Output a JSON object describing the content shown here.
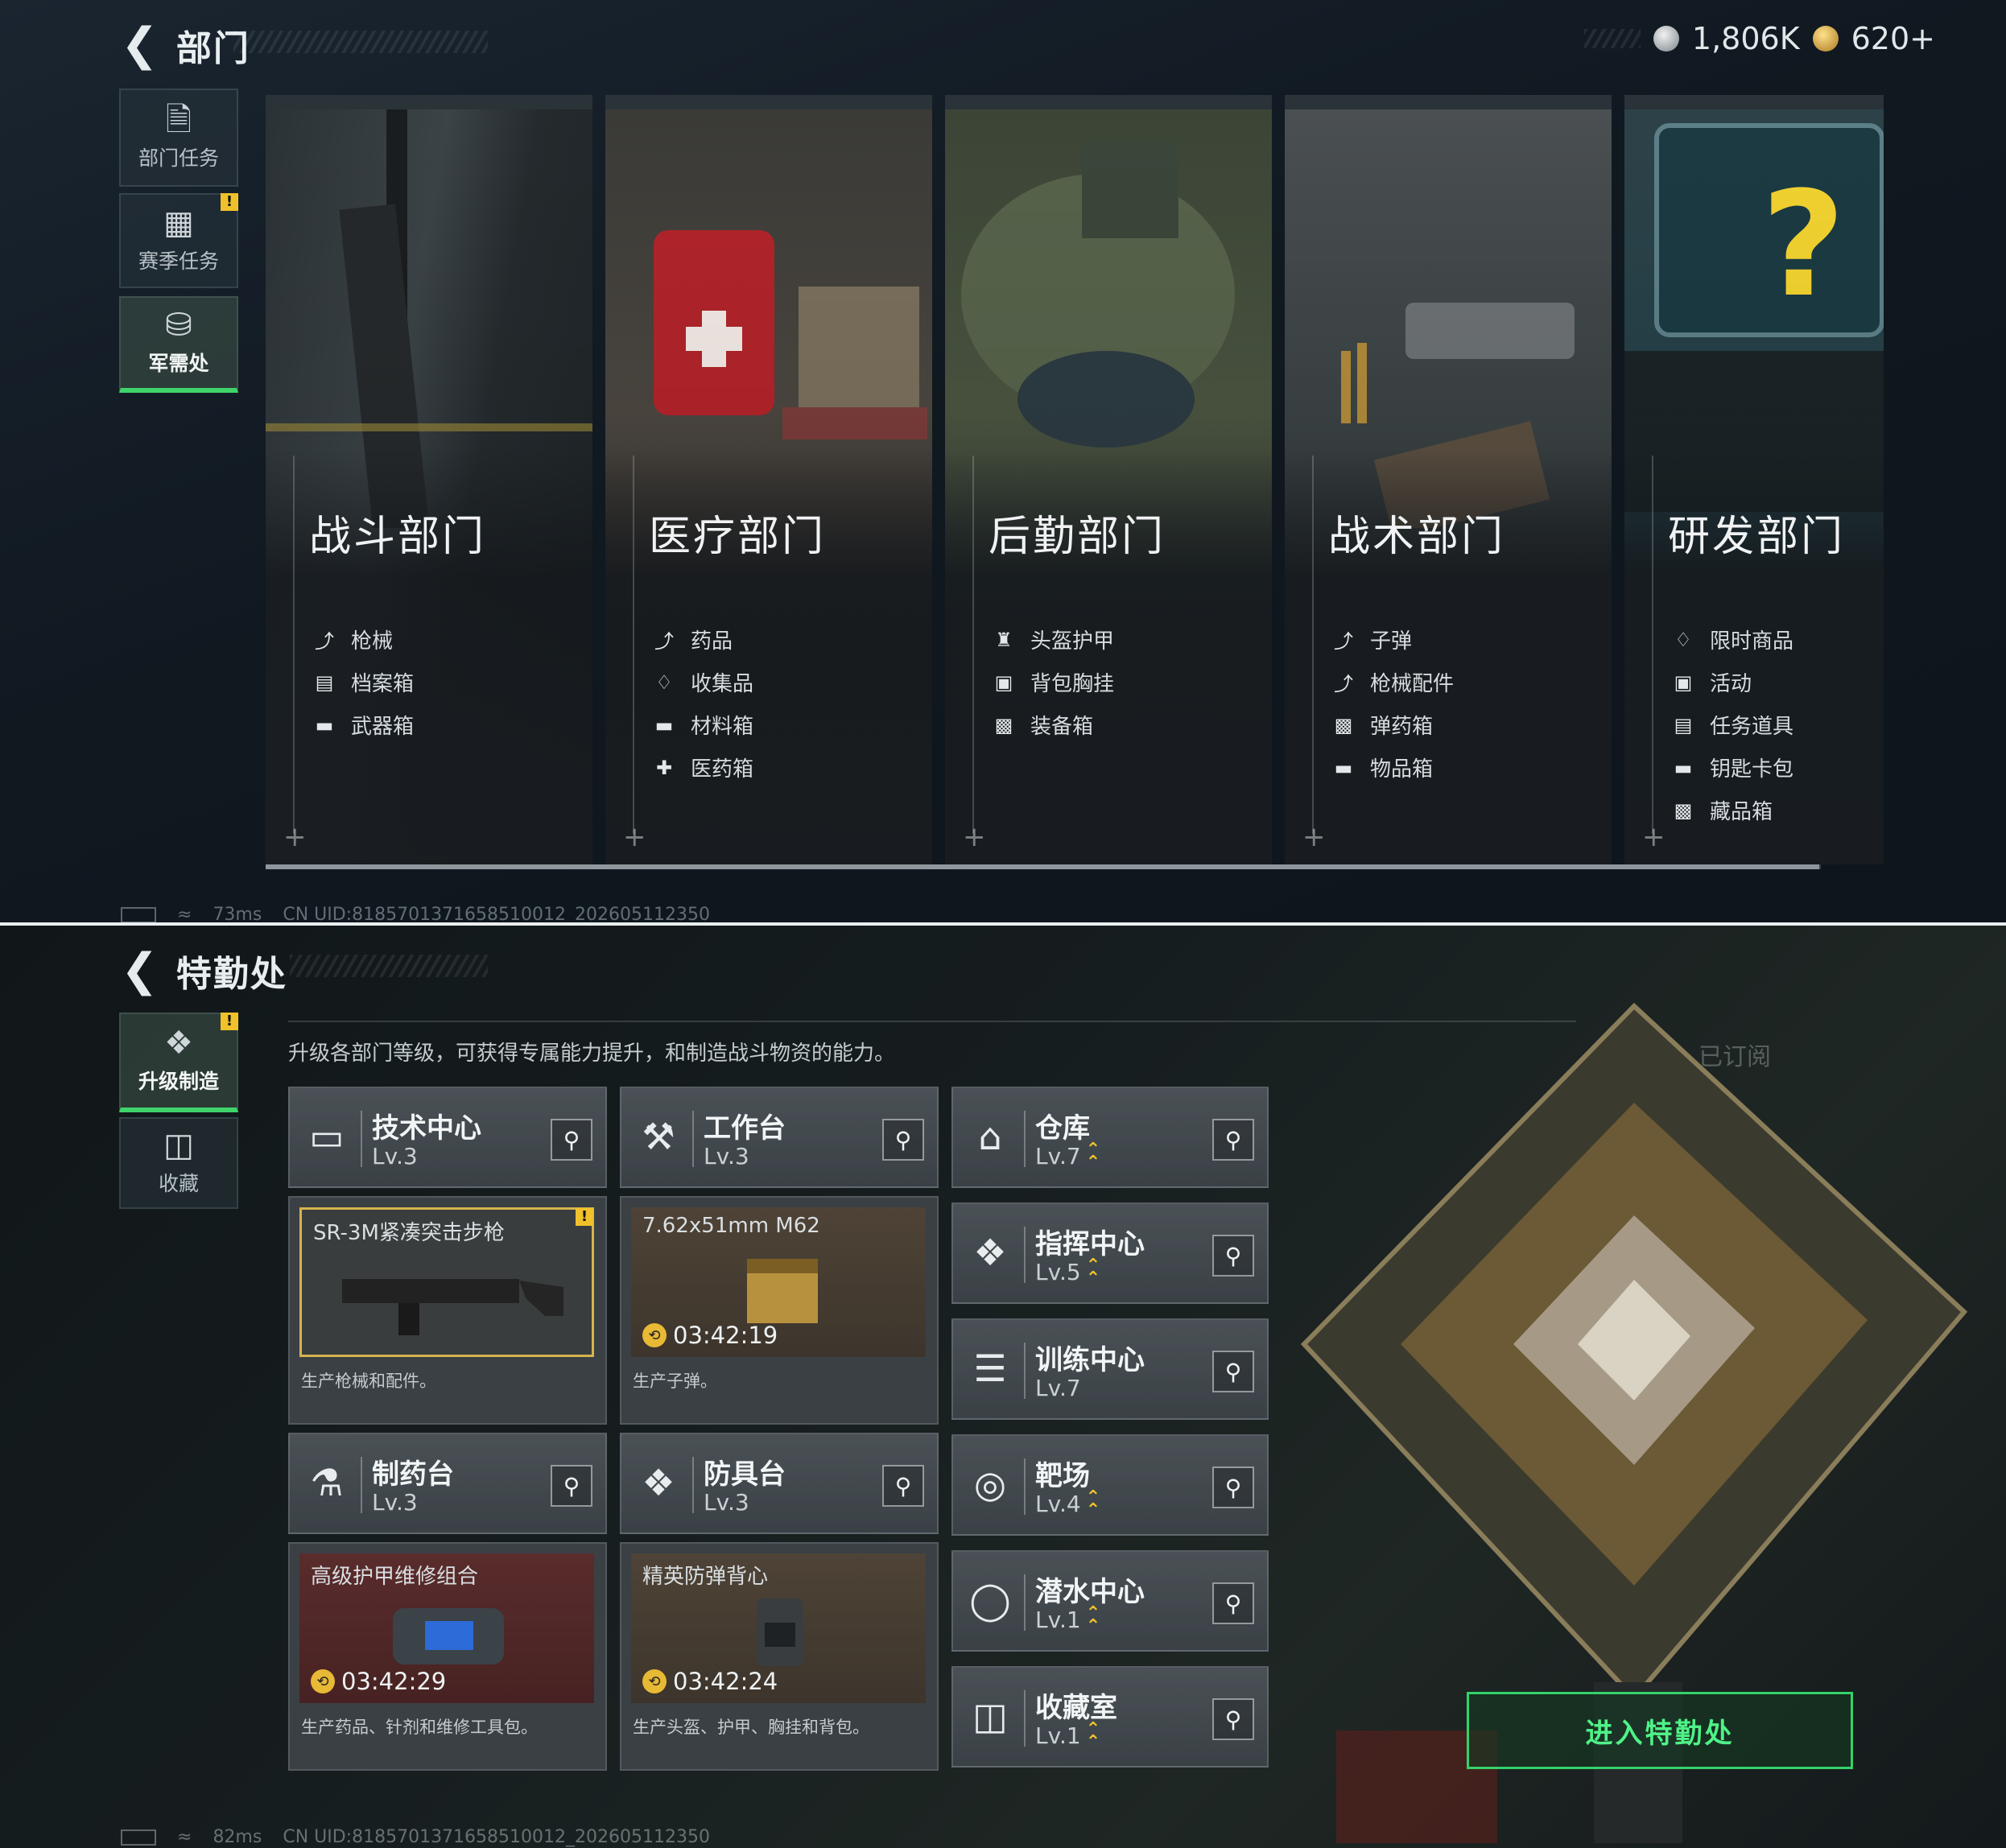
{
  "top": {
    "title": "部门",
    "currency": {
      "silver": "1,806K",
      "gold": "620+"
    },
    "sidebar": [
      {
        "label": "部门任务",
        "icon": "task-doc-icon",
        "active": false,
        "badge": false
      },
      {
        "label": "赛季任务",
        "icon": "season-crate-icon",
        "active": false,
        "badge": true
      },
      {
        "label": "军需处",
        "icon": "coin-stack-icon",
        "active": true,
        "badge": false
      }
    ],
    "departments": [
      {
        "name": "战斗部门",
        "items": [
          "枪械",
          "档案箱",
          "武器箱"
        ]
      },
      {
        "name": "医疗部门",
        "items": [
          "药品",
          "收集品",
          "材料箱",
          "医药箱"
        ]
      },
      {
        "name": "后勤部门",
        "items": [
          "头盔护甲",
          "背包胸挂",
          "装备箱"
        ]
      },
      {
        "name": "战术部门",
        "items": [
          "子弹",
          "枪械配件",
          "弹药箱",
          "物品箱"
        ]
      },
      {
        "name": "研发部门",
        "items": [
          "限时商品",
          "活动",
          "任务道具",
          "钥匙卡包",
          "藏品箱"
        ]
      }
    ],
    "status": {
      "ping": "73ms",
      "uid": "CN UID:818570137165851001​2_202605112350"
    }
  },
  "bottom": {
    "title": "特勤处",
    "description": "升级各部门等级，可获得专属能力提升，和制造战斗物资的能力。",
    "subscribed": "已订阅",
    "sidebar": [
      {
        "label": "升级制造",
        "icon": "upgrade-build-icon",
        "active": true,
        "badge": true
      },
      {
        "label": "收藏",
        "icon": "collection-icon",
        "active": false,
        "badge": false
      }
    ],
    "facilities_main": [
      {
        "name": "技术中心",
        "level": "Lv.3",
        "icon": "monitor-icon",
        "product": {
          "name": "SR-3M紧凑突击步枪",
          "timer": "",
          "desc": "生产枪械和配件。",
          "badge": true
        }
      },
      {
        "name": "工作台",
        "level": "Lv.3",
        "icon": "tools-icon",
        "product": {
          "name": "7.62x51mm M62",
          "timer": "03:42:19",
          "desc": "生产子弹。",
          "badge": false
        }
      },
      {
        "name": "制药台",
        "level": "Lv.3",
        "icon": "flask-icon",
        "product": {
          "name": "高级护甲维修组合",
          "timer": "03:42:29",
          "desc": "生产药品、针剂和维修工具包。",
          "badge": false
        }
      },
      {
        "name": "防具台",
        "level": "Lv.3",
        "icon": "armor-parts-icon",
        "product": {
          "name": "精英防弹背心",
          "timer": "03:42:24",
          "desc": "生产头盔、护甲、胸挂和背包。",
          "badge": false
        }
      }
    ],
    "facilities_side": [
      {
        "name": "仓库",
        "level": "Lv.7",
        "icon": "warehouse-icon",
        "upgrade": true
      },
      {
        "name": "指挥中心",
        "level": "Lv.5",
        "icon": "command-icon",
        "upgrade": true
      },
      {
        "name": "训练中心",
        "level": "Lv.7",
        "icon": "dumbbell-icon",
        "upgrade": false
      },
      {
        "name": "靶场",
        "level": "Lv.4",
        "icon": "target-icon",
        "upgrade": true
      },
      {
        "name": "潜水中心",
        "level": "Lv.1",
        "icon": "diving-mask-icon",
        "upgrade": true
      },
      {
        "name": "收藏室",
        "level": "Lv.1",
        "icon": "vault-icon",
        "upgrade": true
      }
    ],
    "enter_button": "进入特勤处",
    "status": {
      "ping": "82ms",
      "uid": "CN UID:818570137165851001​2_202605112350"
    }
  }
}
